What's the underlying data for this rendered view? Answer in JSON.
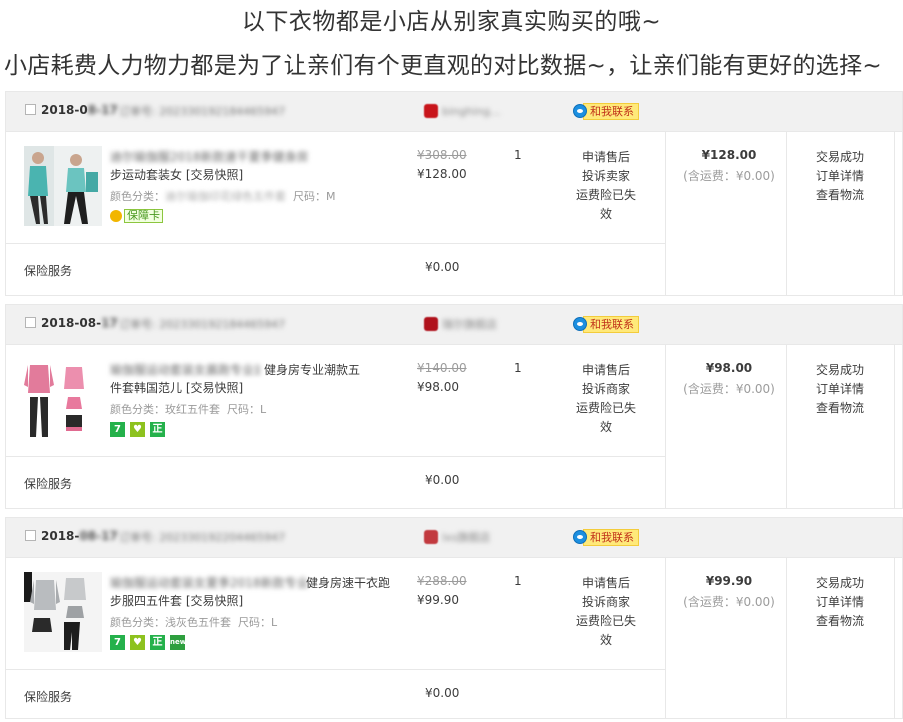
{
  "banner": {
    "line1": "以下衣物都是小店从别家真实购买的哦~",
    "line2": "小店耗费人力物力都是为了让亲们有个更直观的对比数据~，让亲们能有更好的选择~"
  },
  "common": {
    "contact_label": "和我联系",
    "service": [
      "申请售后",
      "投诉卖家",
      "运费险已失效"
    ],
    "status": [
      "交易成功",
      "订单详情",
      "查看物流"
    ],
    "shipping_note": "(含运费：¥0.00)",
    "insurance_label": "保险服务",
    "insurance_price": "¥0.00",
    "guarantee_card": "保障卡"
  },
  "orders": [
    {
      "date_visible": "2018-0",
      "date_blur": "8-17",
      "order_no_blur": "订单号: 202330192184465947",
      "shop_blur": "binghing...",
      "title_blur": "迪尔瑜伽服2018新款速干夏季健身房",
      "title_line2": "步运动套装女 [交易快照]",
      "sku_prefix": "颜色分类：",
      "sku_color_blur": "迪尔瑜伽印花绿色五件套",
      "sku_size": "尺码：M",
      "price_original": "¥308.00",
      "price_now": "¥128.00",
      "quantity": "1",
      "service": [
        "申请售后",
        "投诉卖家",
        "运费险已失效"
      ],
      "pay_amount": "¥128.00"
    },
    {
      "date_visible": "2018-08-",
      "date_blur": "17",
      "order_no_blur": "订单号: 202330192184465947",
      "shop_blur": "瑞尔旗舰店",
      "title_blur": "瑜伽服运动套装女晨跑专业速干瑜伽服",
      "title_row1_tail": "健身房专业潮款五",
      "title_line2": "件套韩国范儿 [交易快照]",
      "sku_prefix": "颜色分类：",
      "sku_color": "玫红五件套",
      "sku_size": "尺码：L",
      "price_original": "¥140.00",
      "price_now": "¥98.00",
      "quantity": "1",
      "service": [
        "申请售后",
        "投诉商家",
        "运费险已失效"
      ],
      "pay_amount": "¥98.00"
    },
    {
      "date_visible": "2018-",
      "date_blur": "08-17",
      "order_no_blur": "订单号: 202330192204465947",
      "shop_blur": "lxs旗舰店",
      "title_blur": "瑜伽服运动套装女夏季2018新款专业",
      "title_row1_tail": "健身房速干衣跑",
      "title_line2": "步服四五件套 [交易快照]",
      "sku_prefix": "颜色分类：",
      "sku_color": "浅灰色五件套",
      "sku_size": "尺码：L",
      "price_original": "¥288.00",
      "price_now": "¥99.90",
      "quantity": "1",
      "service": [
        "申请售后",
        "投诉商家",
        "运费险已失效"
      ],
      "pay_amount": "¥99.90"
    }
  ],
  "colors": {
    "header_bg": "#f1f1f1",
    "border": "#e8e8e8",
    "contact_bg": "#ffe97a",
    "contact_text": "#c0311a",
    "badge_green": "#25b14b"
  },
  "icons": [
    "checkbox-icon",
    "shop-logo-icon",
    "wangwang-icon",
    "guarantee-card-icon",
    "seven-day-return-icon",
    "bao-icon",
    "authentic-icon",
    "new-icon"
  ]
}
